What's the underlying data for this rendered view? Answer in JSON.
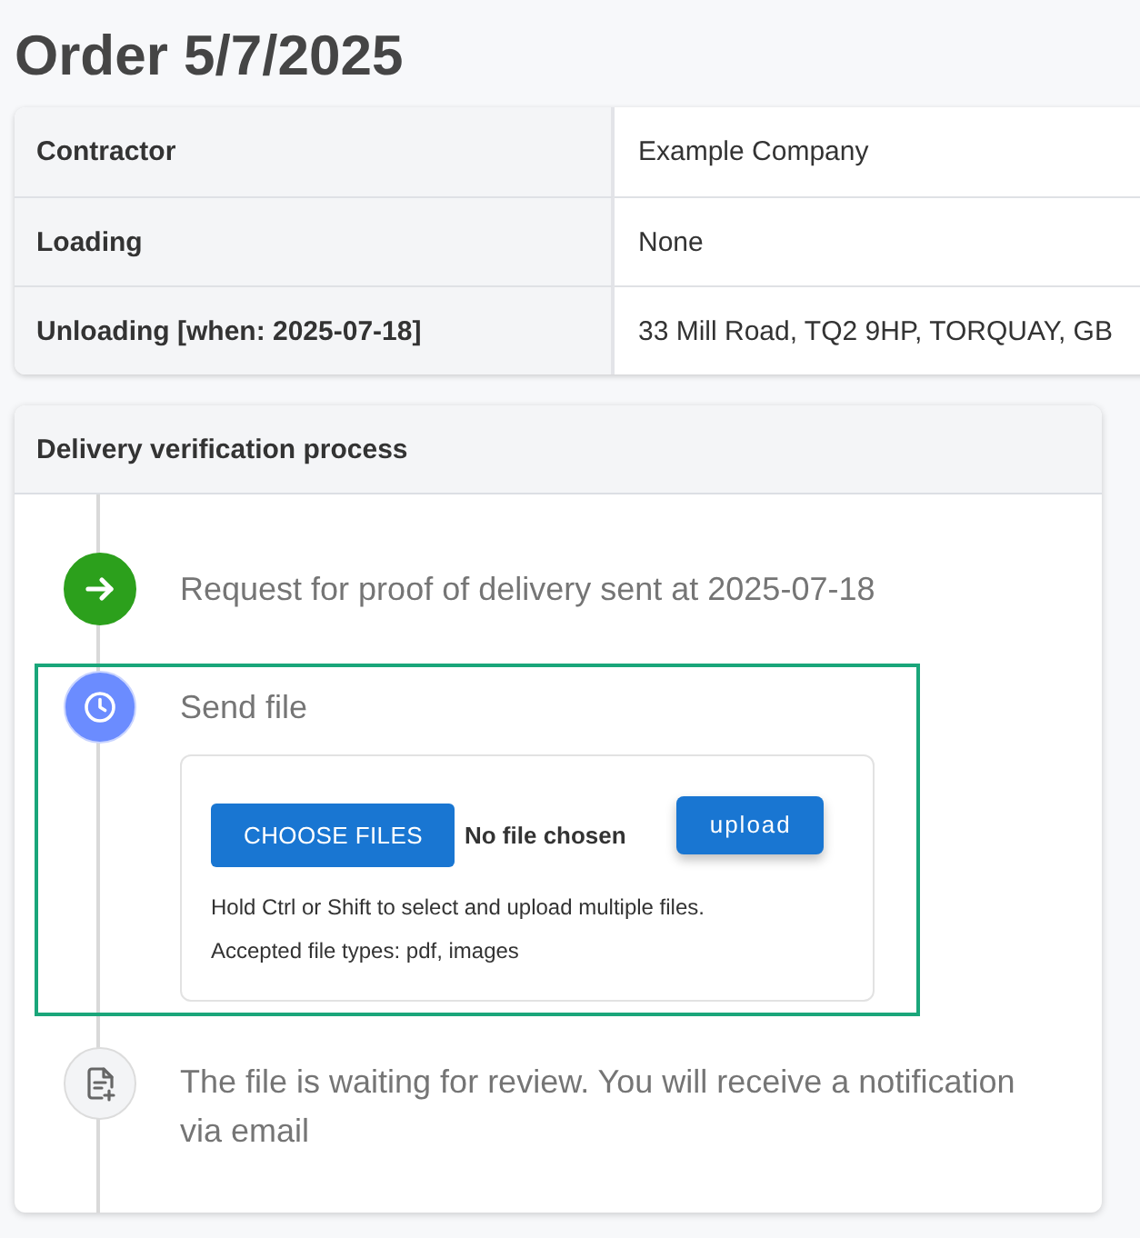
{
  "title": "Order 5/7/2025",
  "details": [
    {
      "label": "Contractor",
      "value": "Example Company"
    },
    {
      "label": "Loading",
      "value": "None"
    },
    {
      "label": "Unloading [when: 2025-07-18]",
      "value": "33 Mill Road, TQ2 9HP, TORQUAY, GB"
    }
  ],
  "process": {
    "title": "Delivery verification process",
    "steps": [
      {
        "kind": "sent",
        "selected": false,
        "text": "Request for proof of delivery sent at 2025-07-18"
      },
      {
        "kind": "upload",
        "selected": true,
        "text": "Send file",
        "upload": {
          "choose_button": "CHOOSE FILES",
          "file_status": "No file chosen",
          "upload_button": "upload",
          "hints": [
            "Hold Ctrl or Shift to select and upload multiple files.",
            "Accepted file types: pdf, images"
          ]
        }
      },
      {
        "kind": "review",
        "selected": false,
        "text": "The file is waiting for review. You will receive a notification via email"
      }
    ]
  }
}
